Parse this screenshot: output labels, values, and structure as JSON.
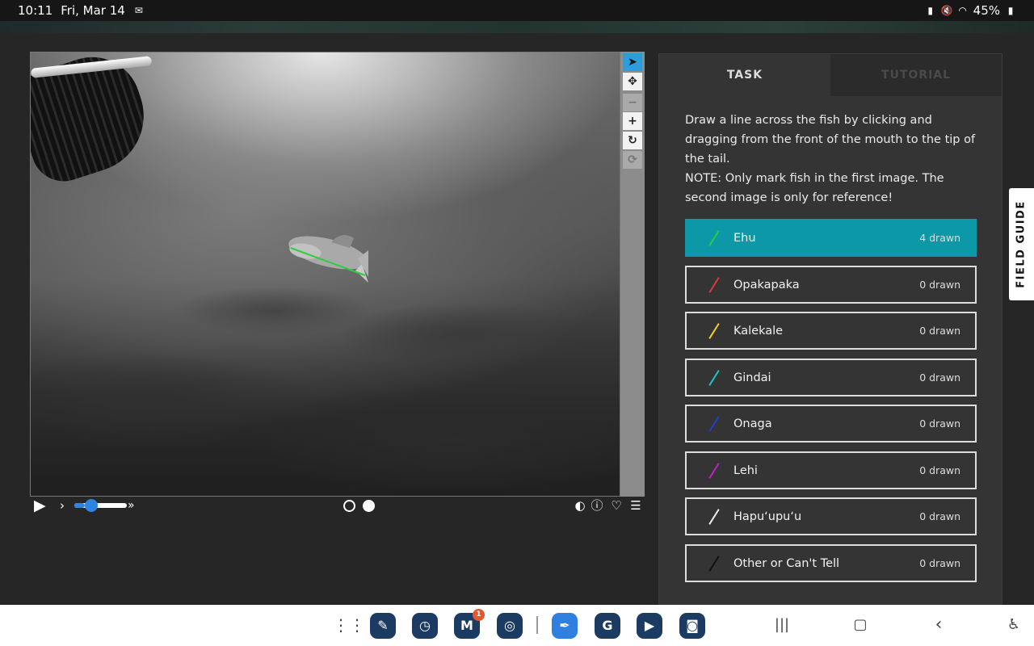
{
  "status_bar": {
    "time": "10:11",
    "date": "Fri, Mar 14",
    "battery": "45%"
  },
  "task_panel": {
    "tabs": [
      {
        "label": "TASK"
      },
      {
        "label": "TUTORIAL"
      }
    ],
    "instructions_line1": "Draw a line across the fish by clicking and dragging from the front of the mouth to the tip of the tail.",
    "instructions_line2": "NOTE: Only mark fish in the first image. The second image is only for reference!",
    "choices": [
      {
        "label": "Ehu",
        "count": "4 drawn",
        "color": "#2ecc40"
      },
      {
        "label": "Opakapaka",
        "count": "0 drawn",
        "color": "#d93a3a"
      },
      {
        "label": "Kalekale",
        "count": "0 drawn",
        "color": "#f0d020"
      },
      {
        "label": "Gindai",
        "count": "0 drawn",
        "color": "#20c0c8"
      },
      {
        "label": "Onaga",
        "count": "0 drawn",
        "color": "#2040c8"
      },
      {
        "label": "Lehi",
        "count": "0 drawn",
        "color": "#c020c0"
      },
      {
        "label": "Hapuʻupuʻu",
        "count": "0 drawn",
        "color": "#eeeeee"
      },
      {
        "label": "Other or Can't Tell",
        "count": "0 drawn",
        "color": "#111111"
      }
    ]
  },
  "field_guide": {
    "label": "FIELD GUIDE"
  },
  "toolbar": {
    "icons": [
      "pointer-icon",
      "move-icon",
      "zoom-out-icon",
      "zoom-in-icon",
      "rotate-icon",
      "reset-icon"
    ]
  },
  "player": {
    "slider_value": 0.2,
    "frames": 2,
    "current_frame": 2
  },
  "navbar": {
    "mail_badge": "1"
  },
  "colors": {
    "accent": "#0c98a6",
    "slider": "#2e84e0",
    "tool_active": "#2e9cdb"
  }
}
